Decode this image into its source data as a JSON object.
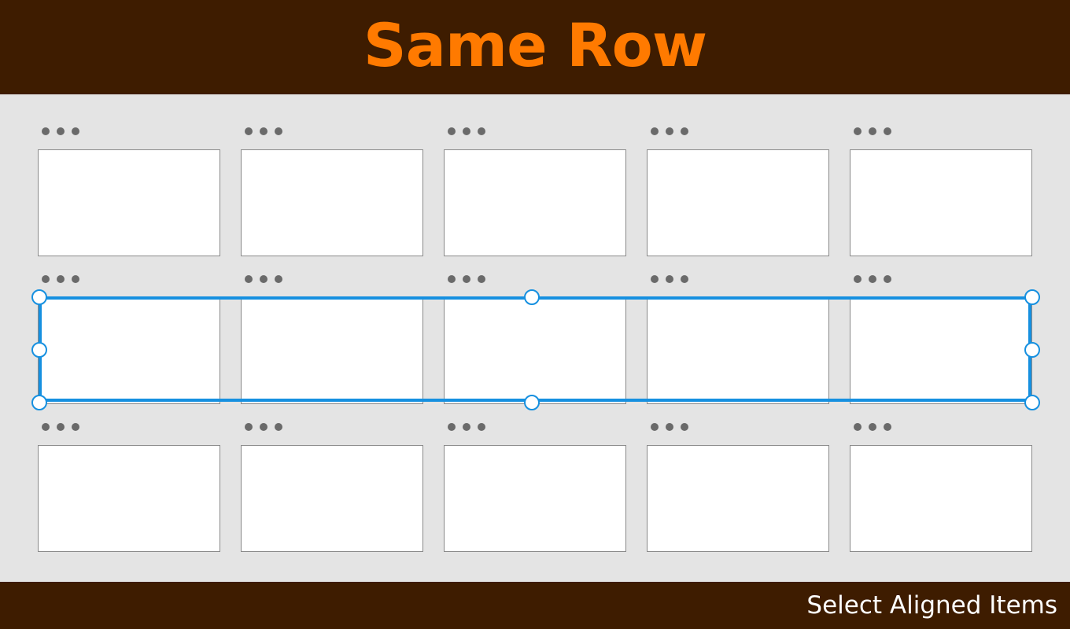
{
  "header": {
    "title": "Same Row"
  },
  "footer": {
    "label": "Select Aligned Items"
  },
  "colors": {
    "background": "#3e1c00",
    "accent": "#ff7a00",
    "canvas": "#e4e4e4",
    "selection": "#1690e0"
  },
  "grid": {
    "rows": 3,
    "columns": 5,
    "selected_row": 2
  },
  "icons": {
    "frame_menu": "more-horizontal-icon",
    "selection_handle": "resize-handle"
  }
}
